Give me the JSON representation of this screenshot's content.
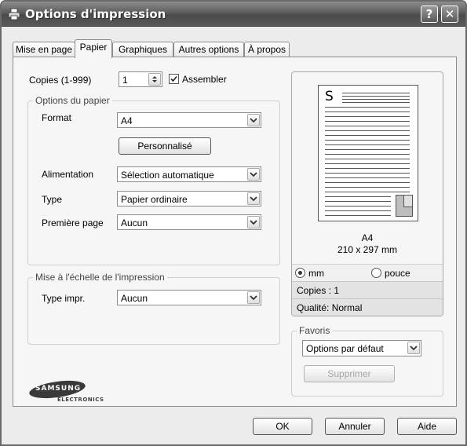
{
  "window": {
    "title": "Options d'impression",
    "help_glyph": "?",
    "close_glyph": "✕"
  },
  "tabs": [
    {
      "label": "Mise en page"
    },
    {
      "label": "Papier"
    },
    {
      "label": "Graphiques"
    },
    {
      "label": "Autres options"
    },
    {
      "label": "À propos"
    }
  ],
  "copies": {
    "label": "Copies (1-999)",
    "value": "1",
    "collate_label": "Assembler",
    "collate_checked": true
  },
  "paper_options": {
    "title": "Options du papier",
    "format_label": "Format",
    "format_value": "A4",
    "custom_button": "Personnalisé",
    "source_label": "Alimentation",
    "source_value": "Sélection automatique",
    "type_label": "Type",
    "type_value": "Papier ordinaire",
    "first_page_label": "Première page",
    "first_page_value": "Aucun"
  },
  "scaling": {
    "title": "Mise à l'échelle de l'impression",
    "type_label": "Type impr.",
    "type_value": "Aucun"
  },
  "preview": {
    "page_letter": "S",
    "paper_name": "A4",
    "paper_size": "210 x 297 mm",
    "unit_mm": "mm",
    "unit_inch": "pouce",
    "unit_selected": "mm",
    "copies_text": "Copies : 1",
    "quality_text": "Qualité: Normal"
  },
  "favorites": {
    "title": "Favoris",
    "value": "Options par défaut",
    "delete_button": "Supprimer"
  },
  "logo": {
    "brand": "SAMSUNG",
    "sub": "ELECTRONICS"
  },
  "buttons": {
    "ok": "OK",
    "cancel": "Annuler",
    "help": "Aide"
  },
  "icons": [
    "printer-icon",
    "help-icon",
    "close-icon",
    "chevron-down-icon",
    "spinner-arrows-icon",
    "checkmark-icon"
  ]
}
